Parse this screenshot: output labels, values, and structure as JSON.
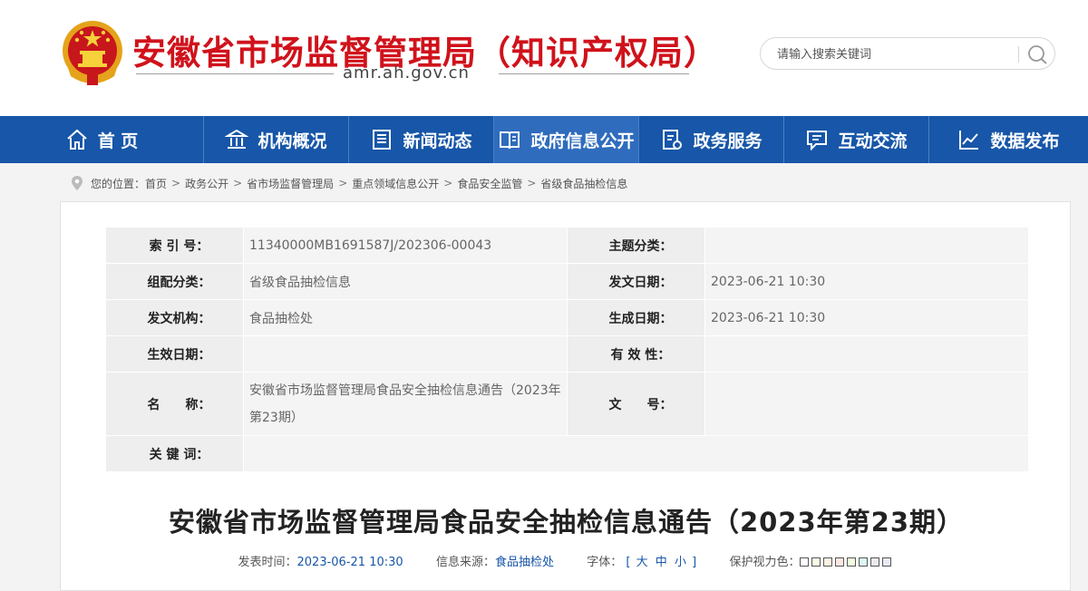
{
  "header": {
    "title": "安徽省市场监督管理局（知识产权局）",
    "domain": "amr.ah.gov.cn",
    "search": {
      "placeholder": "请输入搜索关键词"
    }
  },
  "nav": [
    {
      "label": "首 页",
      "icon": "home-icon"
    },
    {
      "label": "机构概况",
      "icon": "building-icon"
    },
    {
      "label": "新闻动态",
      "icon": "newspaper-icon"
    },
    {
      "label": "政府信息公开",
      "icon": "open-book-icon",
      "active": true
    },
    {
      "label": "政务服务",
      "icon": "service-doc-icon"
    },
    {
      "label": "互动交流",
      "icon": "chat-icon"
    },
    {
      "label": "数据发布",
      "icon": "chart-line-icon"
    }
  ],
  "breadcrumb": {
    "prefix": "您的位置：",
    "items": [
      "首页",
      "政务公开",
      "省市场监督管理局",
      "重点领域信息公开",
      "食品安全监管",
      "省级食品抽检信息"
    ]
  },
  "info": {
    "index_label": "索 引 号：",
    "index_value": "11340000MB1691587J/202306-00043",
    "topic_label": "主题分类：",
    "topic_value": "",
    "group_label": "组配分类：",
    "group_value": "省级食品抽检信息",
    "issue_date_label": "发文日期：",
    "issue_date_value": "2023-06-21 10:30",
    "org_label": "发文机构：",
    "org_value": "食品抽检处",
    "gen_date_label": "生成日期：",
    "gen_date_value": "2023-06-21 10:30",
    "effective_date_label": "生效日期：",
    "effective_date_value": "",
    "validity_label": "有 效 性：",
    "validity_value": "",
    "name_label": "名　　称：",
    "name_value": "安徽省市场监督管理局食品安全抽检信息通告（2023年第23期）",
    "doc_no_label": "文　　号：",
    "doc_no_value": "",
    "keywords_label": "关 键 词：",
    "keywords_value": ""
  },
  "article": {
    "title": "安徽省市场监督管理局食品安全抽检信息通告（2023年第23期）",
    "publish_label": "发表时间：",
    "publish_time": "2023-06-21 10:30",
    "source_label": "信息来源：",
    "source": "食品抽检处",
    "font_label": "字体：",
    "font_open": "[",
    "font_large": "大",
    "font_medium": "中",
    "font_small": "小",
    "font_close": "]",
    "eye_label": "保护视力色："
  },
  "colors": {
    "brand_red": "#d0121b",
    "nav_blue": "#1756a8",
    "nav_active": "#2f6cbd",
    "eye_colors": [
      "#ffffff",
      "#fafbe6",
      "#fff2e2",
      "#fde6e0",
      "#f3ffe1",
      "#dafaf3",
      "#eaeaef",
      "#e8eaf6"
    ]
  }
}
